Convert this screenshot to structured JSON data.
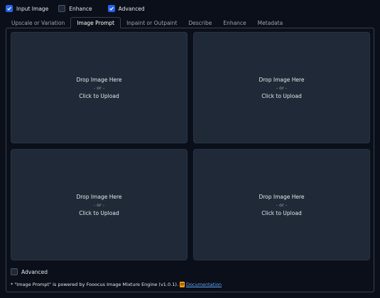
{
  "top_options": [
    {
      "label": "Input Image",
      "checked": true
    },
    {
      "label": "Enhance",
      "checked": false
    },
    {
      "label": "Advanced",
      "checked": true
    }
  ],
  "tabs": [
    {
      "label": "Upscale or Variation",
      "active": false
    },
    {
      "label": "Image Prompt",
      "active": true
    },
    {
      "label": "Inpaint or Outpaint",
      "active": false
    },
    {
      "label": "Describe",
      "active": false
    },
    {
      "label": "Enhance",
      "active": false
    },
    {
      "label": "Metadata",
      "active": false
    }
  ],
  "dropzones": [
    {
      "title": "Drop Image Here",
      "separator": "- or -",
      "action": "Click to Upload"
    },
    {
      "title": "Drop Image Here",
      "separator": "- or -",
      "action": "Click to Upload"
    },
    {
      "title": "Drop Image Here",
      "separator": "- or -",
      "action": "Click to Upload"
    },
    {
      "title": "Drop Image Here",
      "separator": "- or -",
      "action": "Click to Upload"
    }
  ],
  "advanced_option": {
    "label": "Advanced",
    "checked": false
  },
  "footnote": {
    "text": "* \"Image Prompt\" is powered by Fooocus Image Mixture Engine (v1.0.1).",
    "link_label": "Documentation"
  },
  "colors": {
    "background": "#0b0f19",
    "panel": "#1f2937",
    "accent": "#2563eb",
    "link": "#60a5fa"
  }
}
